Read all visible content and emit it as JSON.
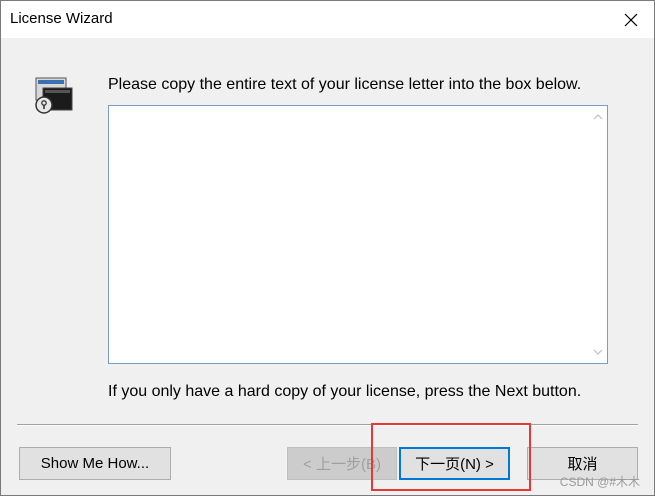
{
  "window": {
    "title": "License Wizard"
  },
  "icons": {
    "close": "close-icon",
    "wizard": "license-wizard-icon",
    "scroll_up": "scroll-up-arrow-icon",
    "scroll_down": "scroll-down-arrow-icon"
  },
  "content": {
    "instruction": "Please copy the entire text of your license letter into the box below.",
    "license_text": {
      "value": "",
      "placeholder": ""
    },
    "hint": "If you only have a hard copy of your license, press the Next button."
  },
  "buttons": {
    "show_me_how": "Show Me How...",
    "back": "< 上一步(B)",
    "next": "下一页(N) >",
    "cancel": "取消"
  },
  "watermark": "CSDN @#木木",
  "colors": {
    "focus_border": "#0078d7",
    "annotation_highlight": "#e53935",
    "dialog_background": "#f0f0f0"
  }
}
